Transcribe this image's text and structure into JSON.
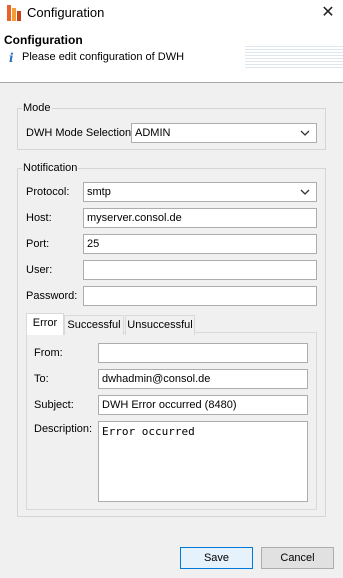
{
  "window": {
    "title": "Configuration",
    "close_glyph": "✕"
  },
  "header": {
    "title": "Configuration",
    "description": "Please edit configuration of DWH",
    "info_glyph": "i"
  },
  "mode": {
    "legend": "Mode",
    "dwh_mode_label": "DWH Mode Selection",
    "dwh_mode_value": "ADMIN"
  },
  "notification": {
    "legend": "Notification",
    "protocol_label": "Protocol:",
    "protocol_value": "smtp",
    "host_label": "Host:",
    "host_value": "myserver.consol.de",
    "port_label": "Port:",
    "port_value": "25",
    "user_label": "User:",
    "user_value": "",
    "password_label": "Password:",
    "password_value": "",
    "tabs": [
      {
        "label": "Error"
      },
      {
        "label": "Successful"
      },
      {
        "label": "Unsuccessful"
      }
    ],
    "from_label": "From:",
    "from_value": "",
    "to_label": "To:",
    "to_value": "dwhadmin@consol.de",
    "subject_label": "Subject:",
    "subject_value": "DWH Error occurred (8480)",
    "description_label": "Description:",
    "description_value": "Error occurred"
  },
  "buttons": {
    "save_label": "Save",
    "cancel_label": "Cancel"
  },
  "colors": {
    "accent": "#0078d7",
    "info": "#2c6fbf"
  }
}
